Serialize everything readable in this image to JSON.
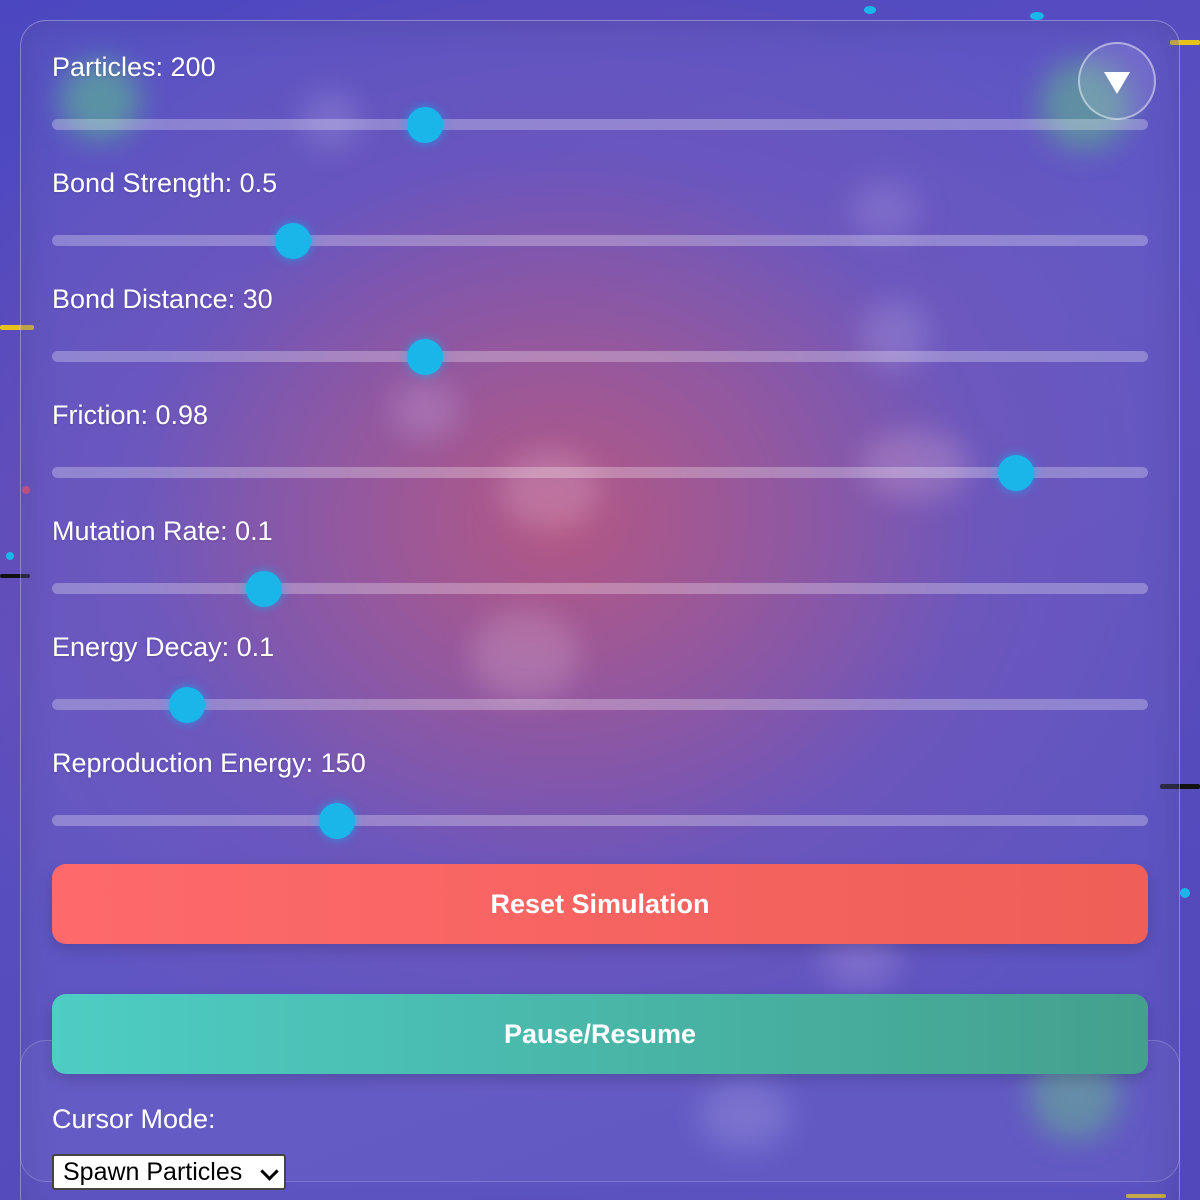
{
  "controls": [
    {
      "label": "Particles: 200",
      "value": 0.34
    },
    {
      "label": "Bond Strength: 0.5",
      "value": 0.22
    },
    {
      "label": "Bond Distance: 30",
      "value": 0.34
    },
    {
      "label": "Friction: 0.98",
      "value": 0.88
    },
    {
      "label": "Mutation Rate: 0.1",
      "value": 0.193
    },
    {
      "label": "Energy Decay: 0.1",
      "value": 0.123
    },
    {
      "label": "Reproduction Energy: 150",
      "value": 0.26
    }
  ],
  "buttons": {
    "reset_label": "Reset Simulation",
    "pause_label": "Pause/Resume"
  },
  "cursor_mode": {
    "label": "Cursor Mode:",
    "selected": "Spawn Particles"
  },
  "icons": {
    "panel_toggle": "triangle-down-icon"
  },
  "colors": {
    "slider_thumb": "#1ab6ea",
    "reset_button": "#fe6a6c",
    "pause_button": "#4ecdc4"
  }
}
